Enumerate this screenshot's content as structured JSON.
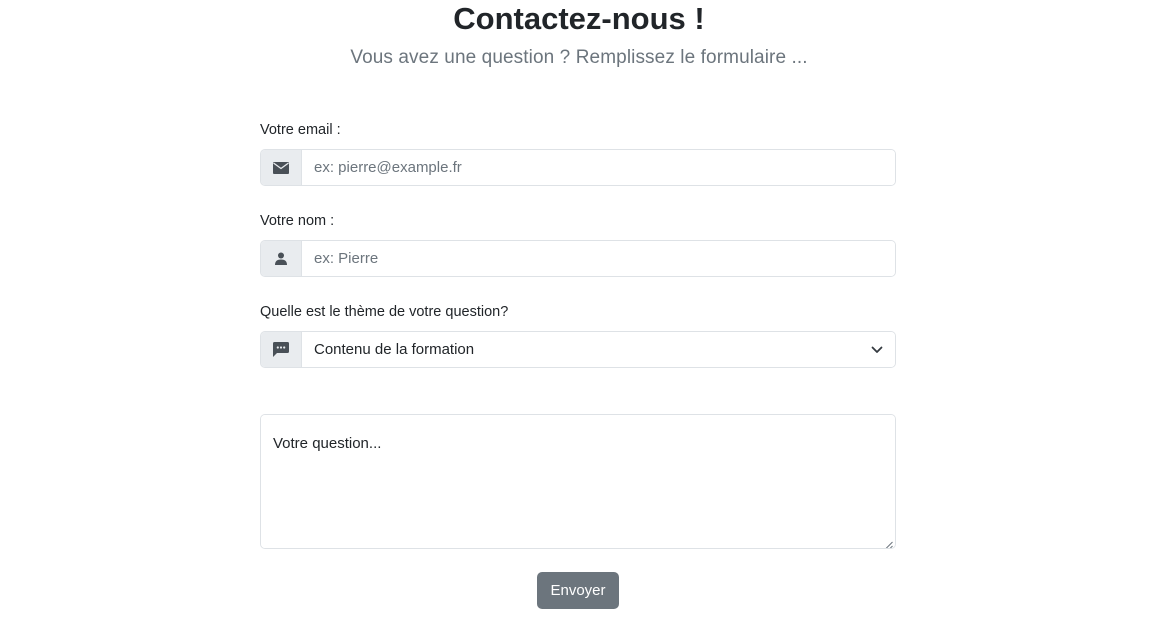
{
  "header": {
    "title": "Contactez-nous !",
    "subtitle": "Vous avez une question ? Remplissez le formulaire ..."
  },
  "form": {
    "email": {
      "label": "Votre email :",
      "placeholder": "ex: pierre@example.fr",
      "value": "",
      "icon": "envelope-icon"
    },
    "name": {
      "label": "Votre nom :",
      "placeholder": "ex: Pierre",
      "value": "",
      "icon": "person-icon"
    },
    "theme": {
      "label": "Quelle est le thème de votre question?",
      "selected": "Contenu de la formation",
      "icon": "chat-bubble-icon"
    },
    "question": {
      "placeholder": "Votre question...",
      "value": ""
    },
    "submit_label": "Envoyer"
  },
  "colors": {
    "text": "#212529",
    "muted": "#6c757d",
    "border": "#dee2e6",
    "addon_bg": "#e9ecef",
    "button_bg": "#6c757d",
    "button_text": "#ffffff"
  }
}
